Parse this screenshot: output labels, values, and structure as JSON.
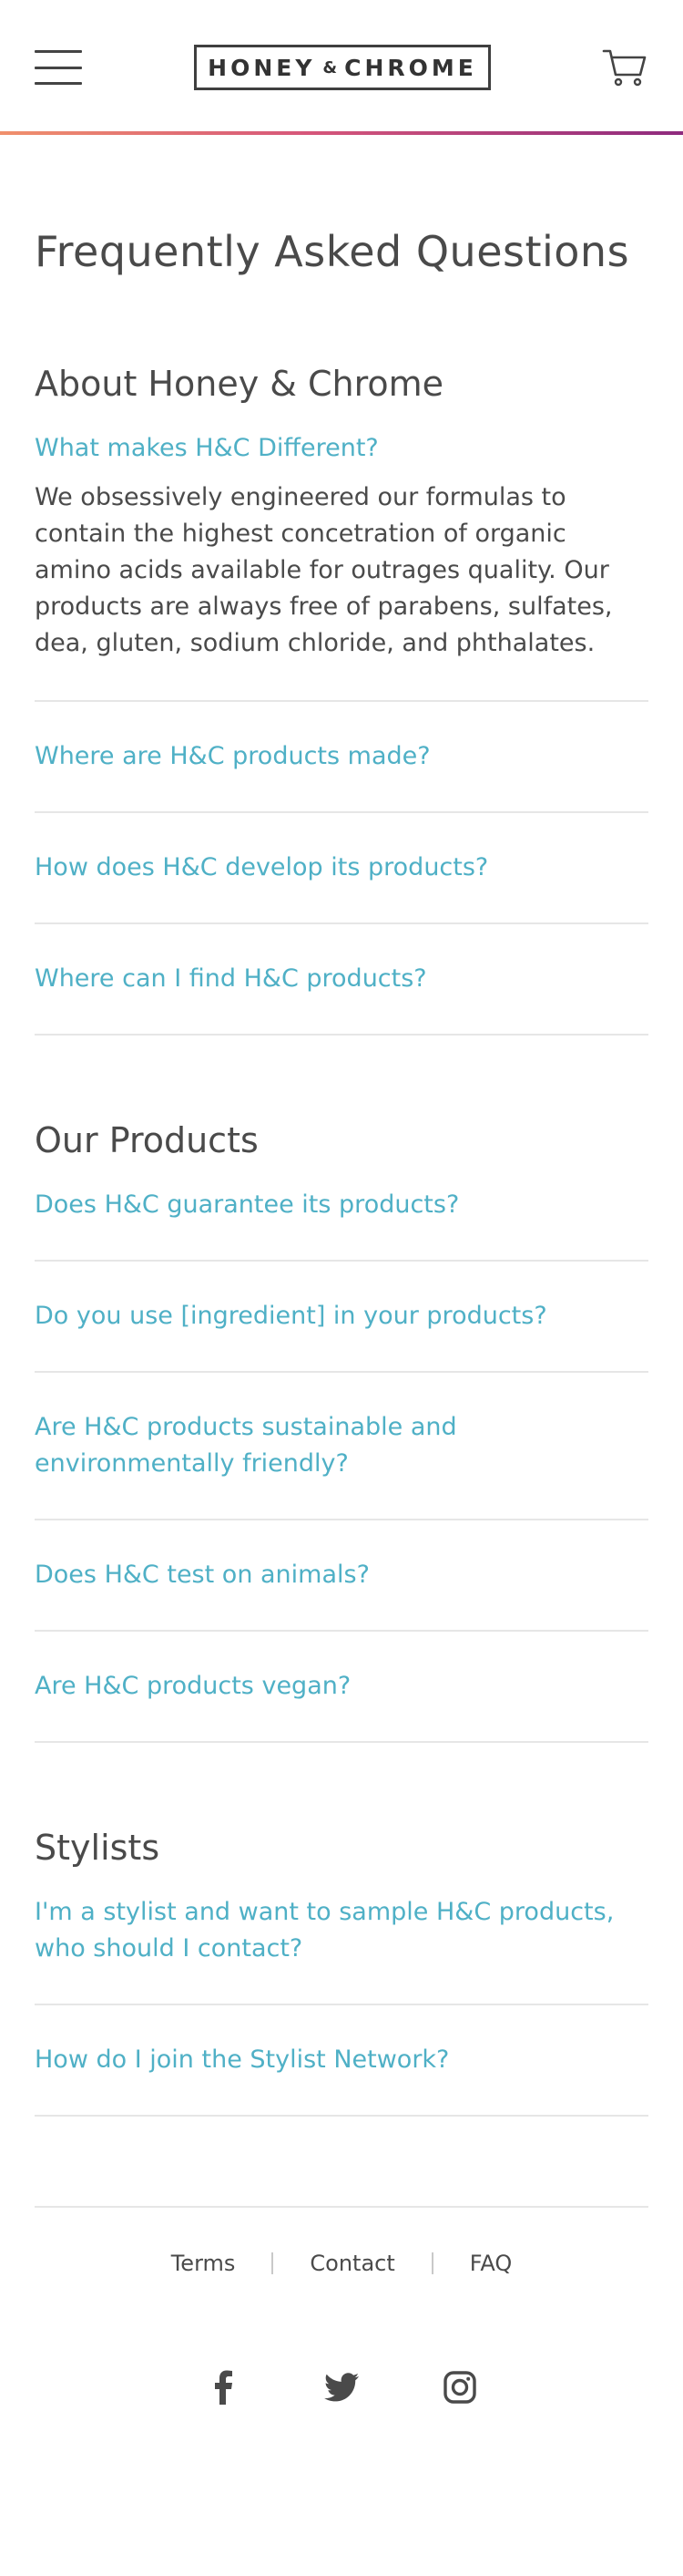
{
  "header": {
    "logo_left": "HONEY",
    "logo_amp": "&",
    "logo_right": "CHROME",
    "menu_icon": "hamburger-menu-icon",
    "cart_icon": "shopping-cart-icon"
  },
  "page_title": "Frequently Asked Questions",
  "sections": [
    {
      "title": "About Honey & Chrome",
      "items": [
        {
          "question": "What makes H&C Different?",
          "answer": "We obsessively engineered our formulas to contain the highest concetration of organic amino acids available for outrages quality. Our products are always free of parabens, sulfates, dea, gluten, sodium chloride, and phthalates."
        },
        {
          "question": "Where are H&C products made?"
        },
        {
          "question": "How does H&C develop its products?"
        },
        {
          "question": "Where can I find H&C products?"
        }
      ]
    },
    {
      "title": "Our Products",
      "items": [
        {
          "question": "Does H&C guarantee its products?"
        },
        {
          "question": "Do you use [ingredient] in your products?"
        },
        {
          "question": "Are H&C products sustainable and environmentally friendly?"
        },
        {
          "question": "Does H&C test on animals?"
        },
        {
          "question": "Are H&C products vegan?"
        }
      ]
    },
    {
      "title": "Stylists",
      "items": [
        {
          "question": "I'm a stylist and want to sample H&C products, who should I contact?"
        },
        {
          "question": "How do I join the Stylist Network?"
        }
      ]
    }
  ],
  "footer": {
    "links": [
      "Terms",
      "Contact",
      "FAQ"
    ],
    "social_icons": [
      "facebook-icon",
      "twitter-icon",
      "instagram-icon"
    ]
  },
  "colors": {
    "accent": "#4fb0c6",
    "text": "#4a4a4a",
    "divider": "#e6e6e6",
    "gradient_start": "#f0906c",
    "gradient_end": "#8e2a7e"
  }
}
